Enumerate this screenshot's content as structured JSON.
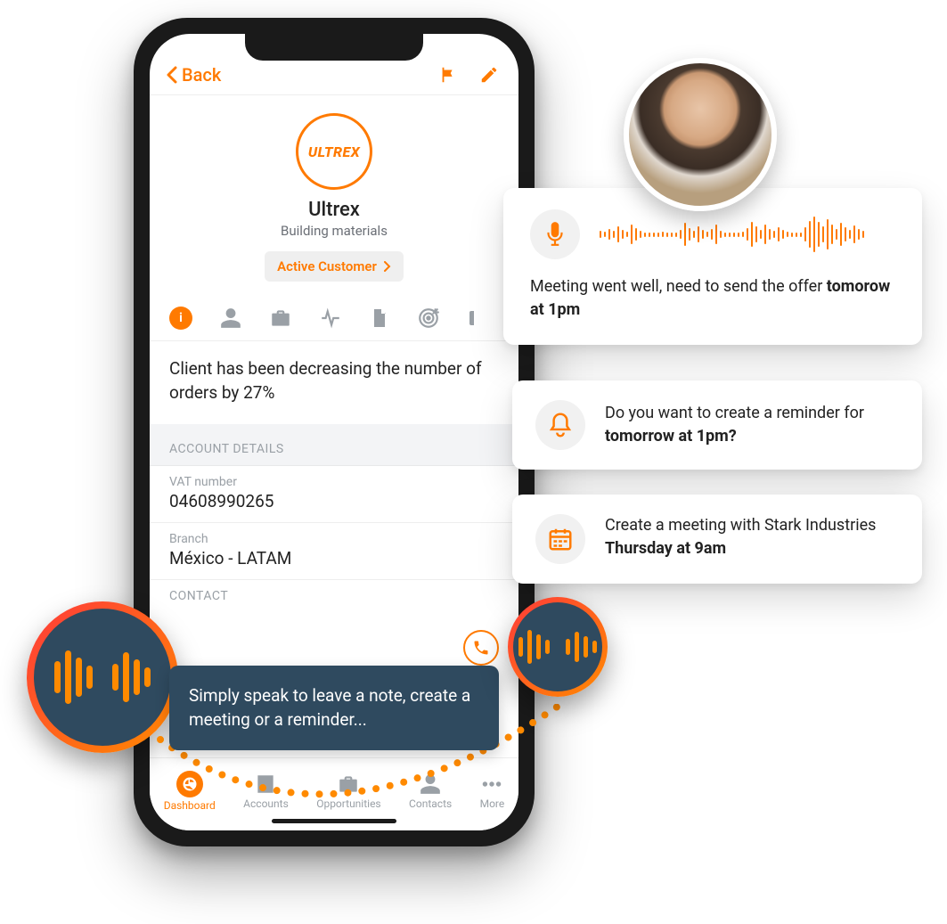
{
  "colors": {
    "accent": "#ff7a00",
    "darkblue": "#2f4a5f"
  },
  "phone": {
    "back_label": "Back",
    "company": {
      "logo_text": "ULTREX",
      "name": "Ultrex",
      "subtitle": "Building materials",
      "status": "Active Customer"
    },
    "insight": "Client has been decreasing the number of orders by 27%",
    "sections": {
      "account_details": "ACCOUNT DETAILS",
      "contact": "CONTACT"
    },
    "fields": {
      "vat_label": "VAT number",
      "vat_value": "04608990265",
      "branch_label": "Branch",
      "branch_value": "México - LATAM"
    },
    "speak_hint": "Simply speak to leave a note, create a meeting or a reminder...",
    "nav": {
      "dashboard": "Dashboard",
      "accounts": "Accounts",
      "opportunities": "Opportunities",
      "contacts": "Contacts",
      "more": "More"
    }
  },
  "cards": {
    "voice": {
      "text_plain": "Meeting went well, need to send the offer ",
      "text_bold": "tomorow at 1pm"
    },
    "reminder": {
      "text_plain": "Do you want to create a reminder for ",
      "text_bold": "tomorrow at 1pm?"
    },
    "meeting": {
      "text_plain": "Create a meeting with Stark Industries ",
      "text_bold": "Thursday at 9am"
    }
  },
  "icons": {
    "back": "back-chevron-icon",
    "flag": "flag-icon",
    "edit": "pencil-icon",
    "info": "info-icon",
    "person": "person-icon",
    "briefcase": "briefcase-icon",
    "activity": "activity-icon",
    "document": "document-icon",
    "target": "target-icon",
    "phone": "phone-icon",
    "mic": "microphone-icon",
    "bell": "bell-icon",
    "calendar": "calendar-icon",
    "wave": "audio-wave-icon",
    "dashboard": "dashboard-icon",
    "building": "building-icon",
    "more": "more-icon"
  }
}
